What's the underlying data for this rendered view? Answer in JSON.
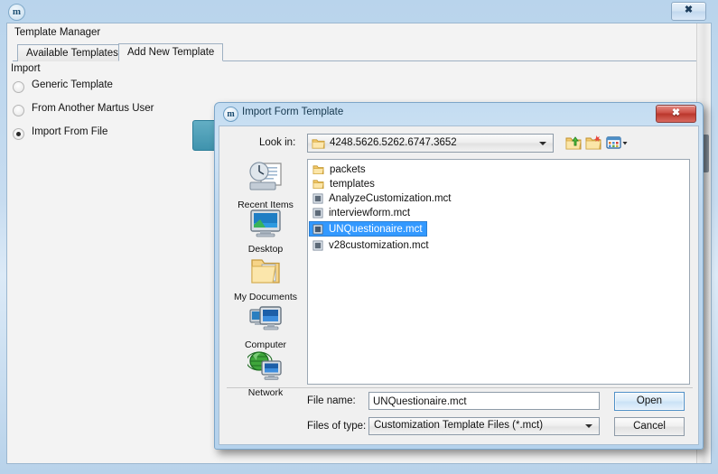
{
  "app": {
    "title_icon": "martus-m-icon",
    "close_label": "✕",
    "panel_title": "Template Manager",
    "tabs": [
      {
        "label": "Available Templates",
        "active": false
      },
      {
        "label": "Add New Template",
        "active": true
      }
    ],
    "group_label": "Import",
    "radios": [
      {
        "label": "Generic Template",
        "checked": false
      },
      {
        "label": "From Another Martus User",
        "checked": false
      },
      {
        "label": "Import From File",
        "checked": true
      }
    ]
  },
  "dialog": {
    "title": "Import Form Template",
    "title_icon": "martus-m-icon",
    "close_label": "✕",
    "lookin": {
      "label": "Look in:",
      "value": "4248.5626.5262.6747.3652",
      "icon": "folder-icon"
    },
    "toolbar": [
      {
        "name": "up-one-level-icon"
      },
      {
        "name": "create-new-folder-icon"
      },
      {
        "name": "view-menu-icon"
      }
    ],
    "places": [
      {
        "label": "Recent Items",
        "icon": "recent-items-icon"
      },
      {
        "label": "Desktop",
        "icon": "desktop-icon"
      },
      {
        "label": "My Documents",
        "icon": "my-documents-icon"
      },
      {
        "label": "Computer",
        "icon": "computer-icon"
      },
      {
        "label": "Network",
        "icon": "network-icon"
      }
    ],
    "files": [
      {
        "name": "packets",
        "type": "folder",
        "selected": false
      },
      {
        "name": "templates",
        "type": "folder",
        "selected": false
      },
      {
        "name": "AnalyzeCustomization.mct",
        "type": "file",
        "selected": false
      },
      {
        "name": "interviewform.mct",
        "type": "file",
        "selected": false
      },
      {
        "name": "UNQuestionaire.mct",
        "type": "file",
        "selected": true
      },
      {
        "name": "v28customization.mct",
        "type": "file",
        "selected": false
      }
    ],
    "filename": {
      "label": "File name:",
      "value": "UNQuestionaire.mct"
    },
    "filetype": {
      "label": "Files of type:",
      "value": "Customization Template Files (*.mct)"
    },
    "buttons": {
      "open": "Open",
      "cancel": "Cancel"
    }
  },
  "colors": {
    "selection_blue": "#3399ff",
    "title_blue": "#b9d4ec",
    "close_red": "#cf5349",
    "teal_accent": "#3f93ad"
  }
}
